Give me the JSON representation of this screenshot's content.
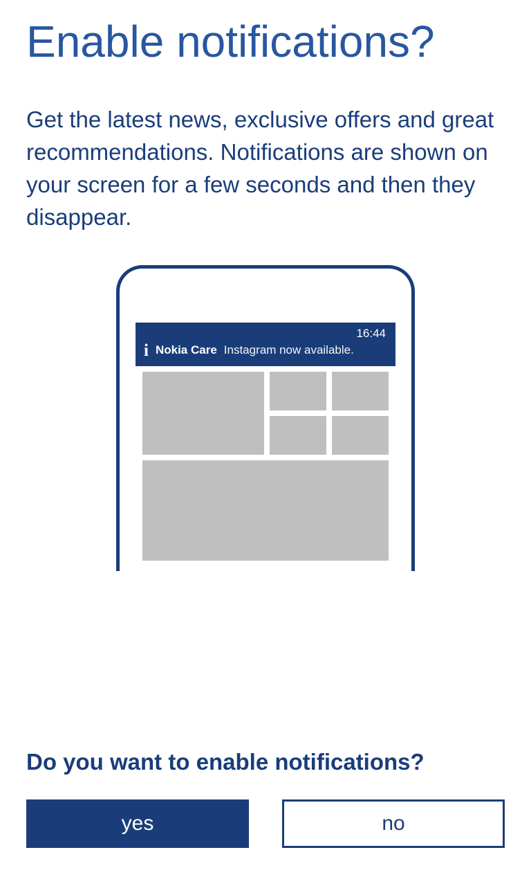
{
  "title": "Enable notifications?",
  "description": "Get the latest news, exclusive offers and great recommendations. Notifications are shown on your screen for a few seconds and then they disappear.",
  "phone": {
    "time": "16:44",
    "app_name": "Nokia Care",
    "notification_text": "Instagram now available."
  },
  "question": "Do you want to enable notifications?",
  "buttons": {
    "yes": "yes",
    "no": "no"
  }
}
